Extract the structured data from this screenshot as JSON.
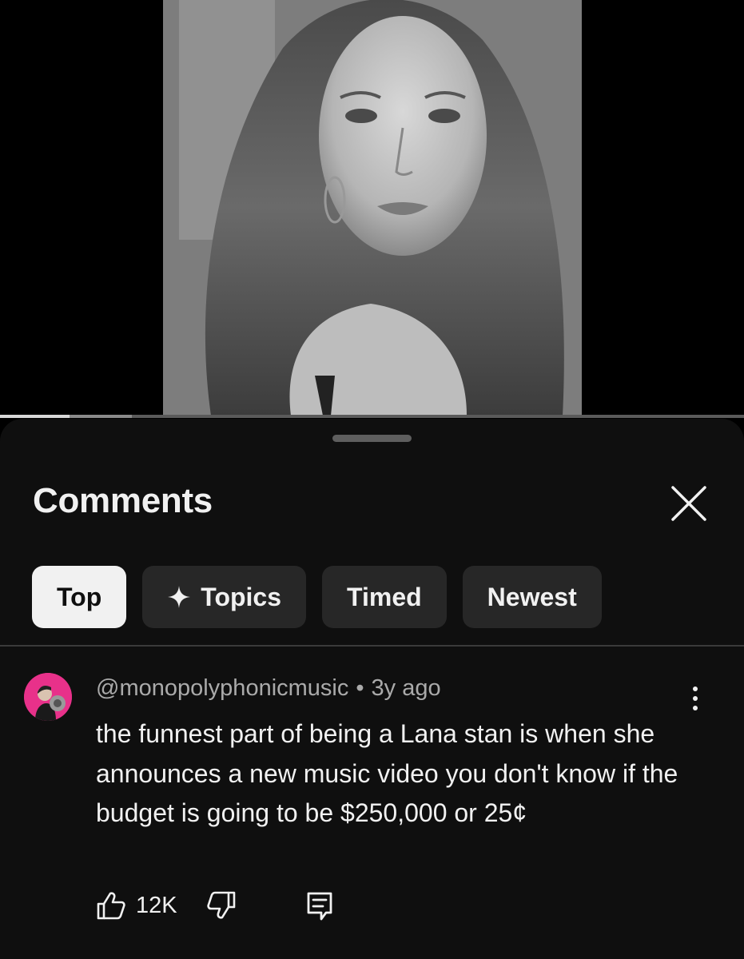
{
  "sheet": {
    "title": "Comments"
  },
  "video": {
    "progress_played": 0.093,
    "progress_buffered": 0.177
  },
  "filters": [
    {
      "label": "Top",
      "active": true
    },
    {
      "label": "Topics",
      "active": false,
      "icon": "sparkle-icon"
    },
    {
      "label": "Timed",
      "active": false
    },
    {
      "label": "Newest",
      "active": false
    }
  ],
  "comment": {
    "author": "@monopolyphonicmusic",
    "separator": "•",
    "time": "3y ago",
    "text": "the funnest part of being a Lana stan is when she announces a new music video you don't know if the budget is going to be $250,000 or 25¢",
    "likes": "12K",
    "avatar_color": "#e8318a"
  },
  "colors": {
    "sheet_bg": "#0f0f0f",
    "chip_bg": "#272727",
    "chip_active_bg": "#f1f1f1",
    "text_primary": "#f1f1f1",
    "text_secondary": "#aaaaaa"
  }
}
